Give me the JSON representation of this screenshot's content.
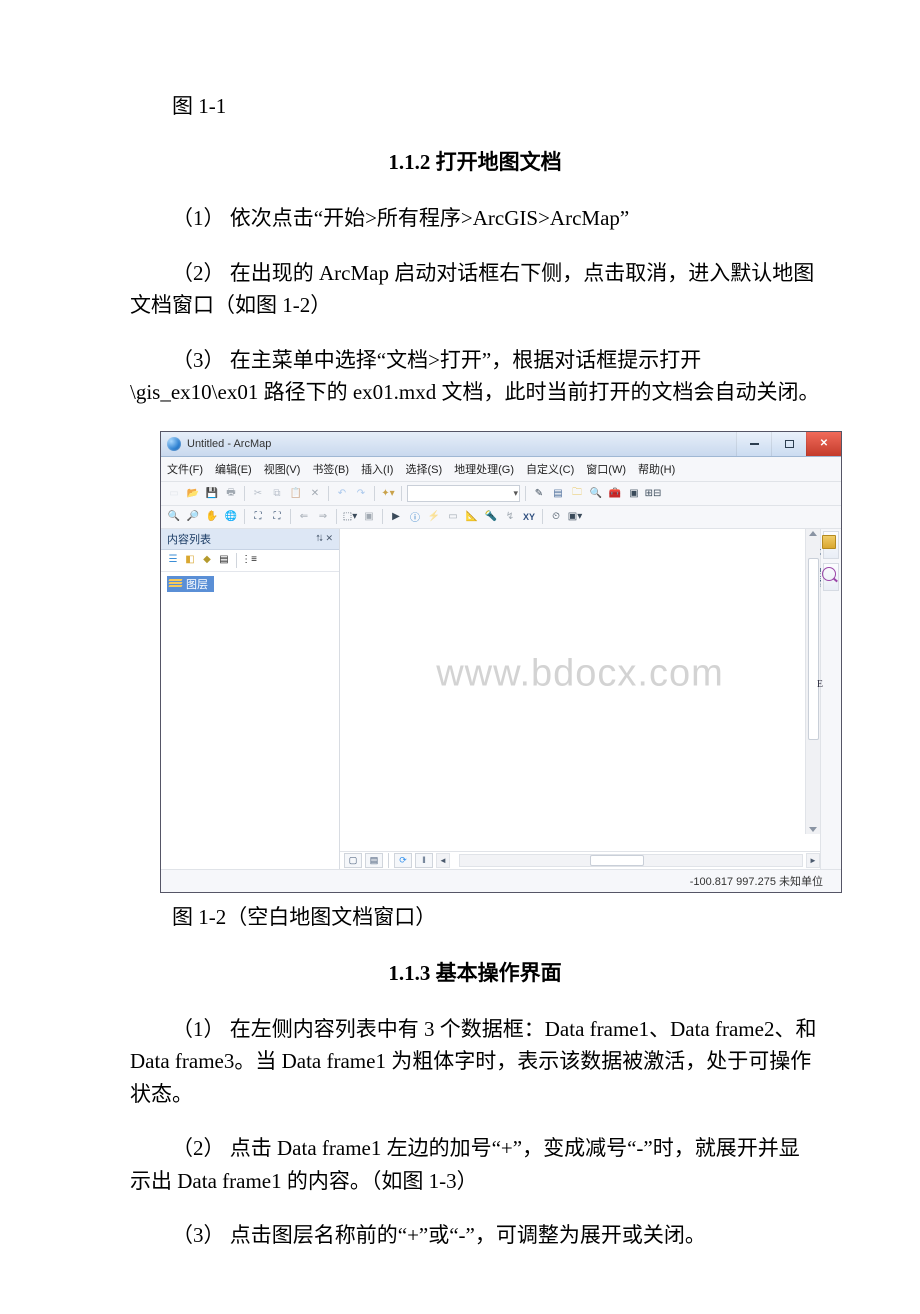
{
  "caption1": "图 1-1",
  "heading1": "1.1.2 打开地图文档",
  "p1": "（1） 依次点击“开始>所有程序>ArcGIS>ArcMap”",
  "p2": "（2） 在出现的 ArcMap 启动对话框右下侧，点击取消，进入默认地图文档窗口（如图 1-2）",
  "p3": "（3） 在主菜单中选择“文档>打开”，根据对话框提示打开 \\gis_ex10\\ex01 路径下的 ex01.mxd 文档，此时当前打开的文档会自动关闭。",
  "caption2": "图 1-2（空白地图文档窗口）",
  "heading2": "1.1.3 基本操作界面",
  "p4": "（1） 在左侧内容列表中有 3 个数据框：Data frame1、Data frame2、和 Data frame3。当 Data frame1 为粗体字时，表示该数据被激活，处于可操作状态。",
  "p5": "（2） 点击 Data frame1 左边的加号“+”，变成减号“-”时，就展开并显示出 Data frame1 的内容。（如图 1-3）",
  "p6": "（3） 点击图层名称前的“+”或“-”，可调整为展开或关闭。",
  "screenshot": {
    "title": "Untitled - ArcMap",
    "menubar": [
      "文件(F)",
      "编辑(E)",
      "视图(V)",
      "书签(B)",
      "插入(I)",
      "选择(S)",
      "地理处理(G)",
      "自定义(C)",
      "窗口(W)",
      "帮助(H)"
    ],
    "toc_title": "内容列表",
    "toc_pin": [
      "⮁",
      "✕"
    ],
    "toc_item": "图层",
    "watermark": "www.bdocx.com",
    "status": "-100.817  997.275 未知单位",
    "right_tabs": [
      "目录",
      "搜索"
    ],
    "scroll_mark": "E"
  }
}
